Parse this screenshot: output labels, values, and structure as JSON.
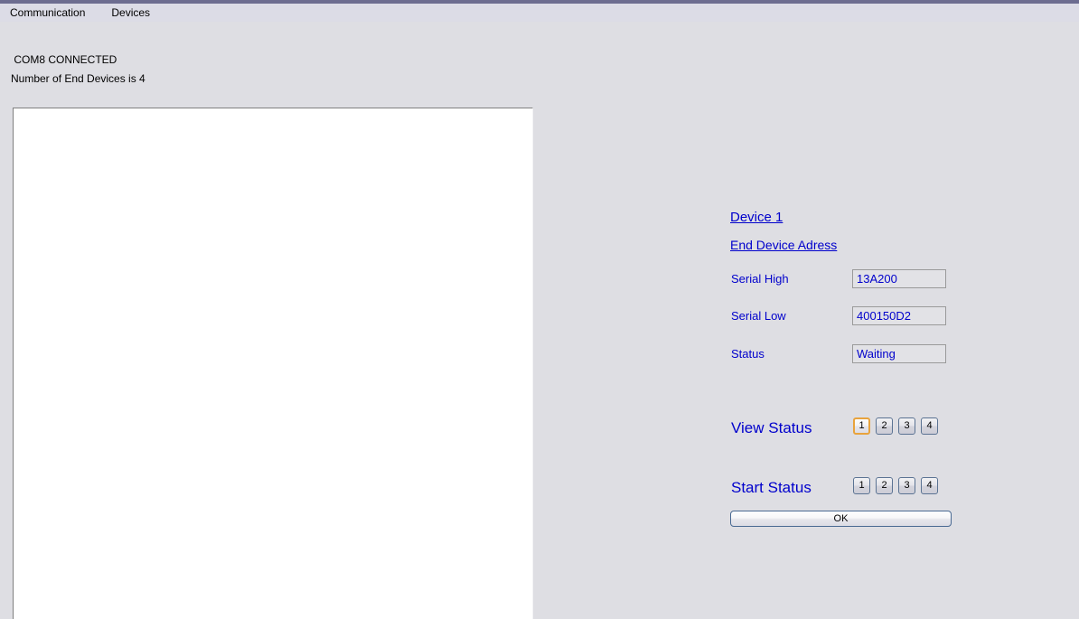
{
  "menu": {
    "items": [
      {
        "label": "Communication"
      },
      {
        "label": "Devices"
      }
    ]
  },
  "status": {
    "com_status": " COM8 CONNECTED",
    "device_count": "Number of End Devices is 4"
  },
  "log_panel": {
    "content": ""
  },
  "form": {
    "device_title": "Device 1",
    "section_heading": "End Device Adress",
    "fields": [
      {
        "label": "Serial High",
        "value": "13A200"
      },
      {
        "label": "Serial Low",
        "value": "400150D2"
      },
      {
        "label": "Status",
        "value": "Waiting"
      }
    ],
    "view_status": {
      "label": "View Status",
      "buttons": [
        "1",
        "2",
        "3",
        "4"
      ],
      "selected_index": 0
    },
    "start_status": {
      "label": "Start Status",
      "buttons": [
        "1",
        "2",
        "3",
        "4"
      ],
      "selected_index": -1
    },
    "ok_label": "OK"
  },
  "colors": {
    "window_background": "#dedee3",
    "menubar_background": "#dcdce6",
    "menubar_top_border": "#6d6d90",
    "link_blue": "#0000cc",
    "field_background": "#e2e2e6",
    "field_border": "#9a9a9a",
    "button_border": "#5b7393",
    "focus_orange": "#e8a33d",
    "panel_white": "#ffffff"
  }
}
